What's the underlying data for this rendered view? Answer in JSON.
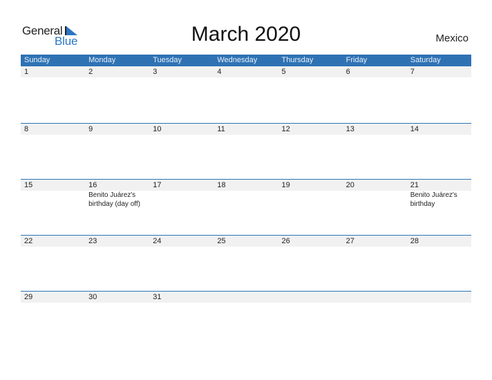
{
  "logo": {
    "word1": "General",
    "word2": "Blue"
  },
  "title": "March 2020",
  "country": "Mexico",
  "colors": {
    "header": "#2e72b4",
    "brand": "#2b75c5",
    "strip": "#f1f1f1"
  },
  "weekdays": [
    "Sunday",
    "Monday",
    "Tuesday",
    "Wednesday",
    "Thursday",
    "Friday",
    "Saturday"
  ],
  "weeks": [
    {
      "days": [
        "1",
        "2",
        "3",
        "4",
        "5",
        "6",
        "7"
      ],
      "events": [
        "",
        "",
        "",
        "",
        "",
        "",
        ""
      ]
    },
    {
      "days": [
        "8",
        "9",
        "10",
        "11",
        "12",
        "13",
        "14"
      ],
      "events": [
        "",
        "",
        "",
        "",
        "",
        "",
        ""
      ]
    },
    {
      "days": [
        "15",
        "16",
        "17",
        "18",
        "19",
        "20",
        "21"
      ],
      "events": [
        "",
        "Benito Juárez's birthday (day off)",
        "",
        "",
        "",
        "",
        "Benito Juárez's birthday"
      ]
    },
    {
      "days": [
        "22",
        "23",
        "24",
        "25",
        "26",
        "27",
        "28"
      ],
      "events": [
        "",
        "",
        "",
        "",
        "",
        "",
        ""
      ]
    },
    {
      "days": [
        "29",
        "30",
        "31",
        "",
        "",
        "",
        ""
      ],
      "events": [
        "",
        "",
        "",
        "",
        "",
        "",
        ""
      ]
    }
  ]
}
